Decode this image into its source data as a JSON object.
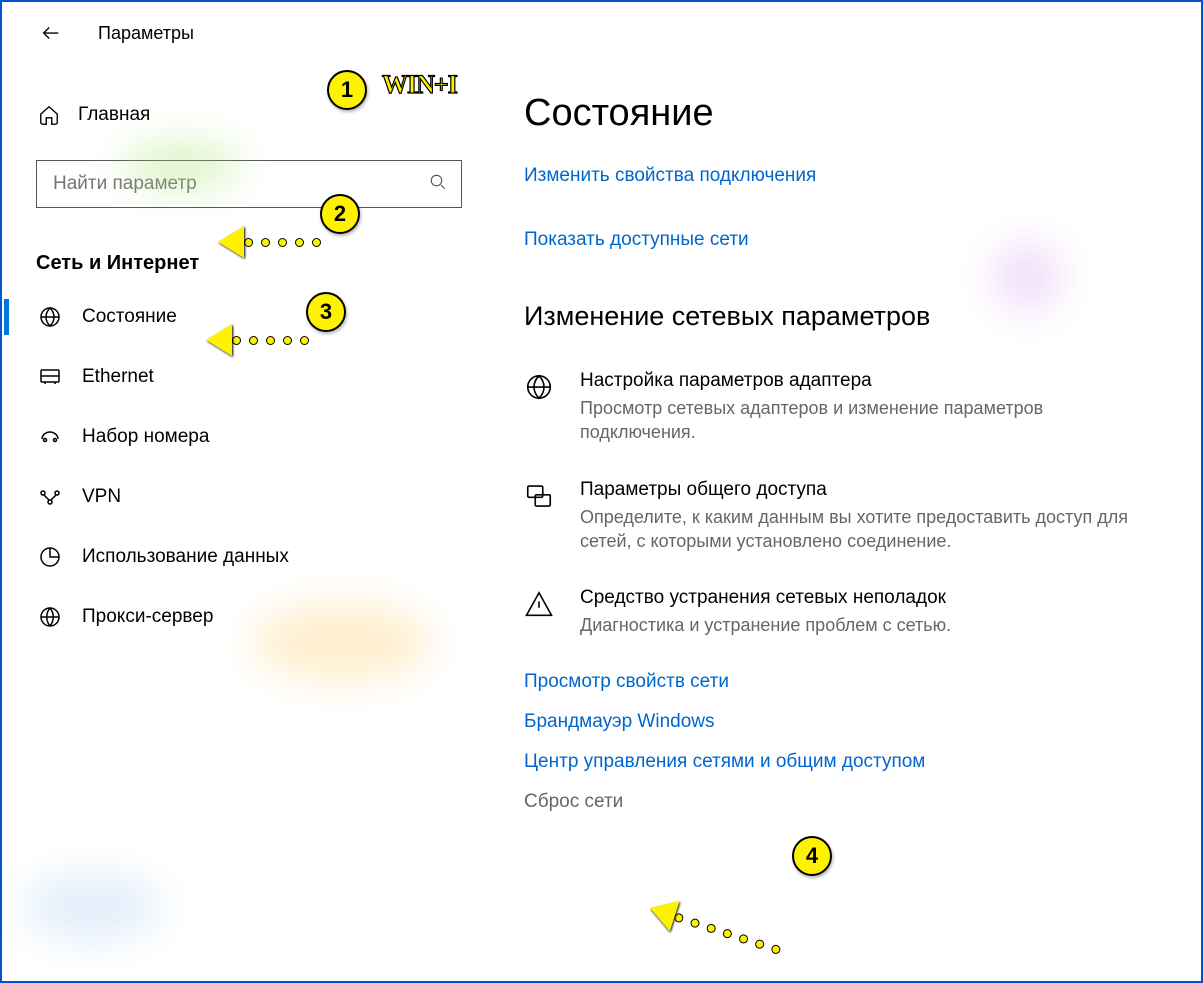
{
  "app": {
    "title": "Параметры"
  },
  "sidebar": {
    "home": "Главная",
    "search_placeholder": "Найти параметр",
    "section": "Сеть и Интернет",
    "items": [
      {
        "label": "Состояние",
        "icon": "globe"
      },
      {
        "label": "Ethernet",
        "icon": "ethernet"
      },
      {
        "label": "Набор номера",
        "icon": "dialup"
      },
      {
        "label": "VPN",
        "icon": "vpn"
      },
      {
        "label": "Использование данных",
        "icon": "data"
      },
      {
        "label": "Прокси-сервер",
        "icon": "proxy"
      }
    ]
  },
  "main": {
    "title": "Состояние",
    "link_change_props": "Изменить свойства подключения",
    "link_show_networks": "Показать доступные сети",
    "subheading": "Изменение сетевых параметров",
    "options": [
      {
        "title": "Настройка параметров адаптера",
        "desc": "Просмотр сетевых адаптеров и изменение параметров подключения."
      },
      {
        "title": "Параметры общего доступа",
        "desc": "Определите, к каким данным вы хотите предоставить доступ для сетей, с которыми установлено соединение."
      },
      {
        "title": "Средство устранения сетевых неполадок",
        "desc": "Диагностика и устранение проблем с сетью."
      }
    ],
    "link_view_props": "Просмотр свойств сети",
    "link_firewall": "Брандмауэр Windows",
    "link_sharing_center": "Центр управления сетями и общим доступом",
    "link_reset": "Сброс сети"
  },
  "annotations": {
    "one": "1",
    "two": "2",
    "three": "3",
    "four": "4",
    "wini": "WIN+I"
  }
}
